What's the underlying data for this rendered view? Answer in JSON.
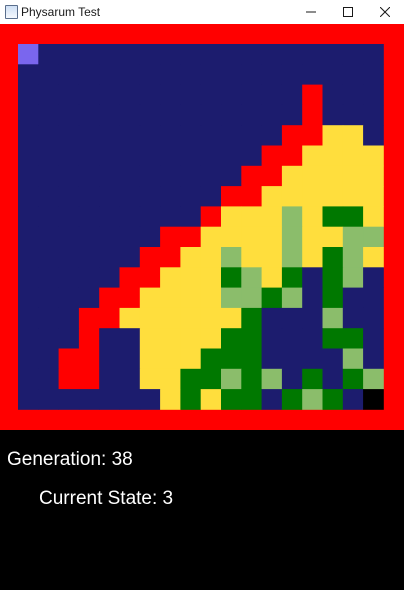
{
  "window": {
    "title": "Physarum Test",
    "icons": {
      "app": "app-window-icon",
      "minimize": "minimize-icon",
      "maximize": "maximize-icon",
      "close": "close-icon"
    }
  },
  "status": {
    "generation_label": "Generation: 38",
    "state_label": "Current State: 3"
  },
  "palette": {
    "B": "#1c1c6e",
    "R": "#ff0000",
    "Y": "#ffde3d",
    "G": "#007800",
    "L": "#8bbd6b",
    "P": "#7a66ee",
    "K": "#000000"
  },
  "grid": {
    "cols": 18,
    "rows": 18,
    "cells": [
      "PBBBBBBBBBBBBBBBBB",
      "BBBBBBBBBBBBBBBBBB",
      "BBBBBBBBBBBBBBRBBB",
      "BBBBBBBBBBBBBBRBBB",
      "BBBBBBBBBBBBBRRYYB",
      "BBBBBBBBBBBBRRYYYY",
      "BBBBBBBBBBBRRYYYYY",
      "BBBBBBBBBBRRYYYYYY",
      "BBBBBBBBBRYYYLYGGY",
      "BBBBBBBRRYYYYLYYLL",
      "BBBBBBRRYYLYYLYGLY",
      "BBBBBRRYYYGLYGBGLB",
      "BBBBRRYYYYLLGLBGBB",
      "BBBRRYYYYYYGBBBLBB",
      "BBBRBBYYYYGGBBBGGB",
      "BBRRBBYYYGGGBBBBLB",
      "BBRRBBYYGGLGLBGBGL",
      "BBBBBBBYGYGGBGLGBK"
    ]
  }
}
